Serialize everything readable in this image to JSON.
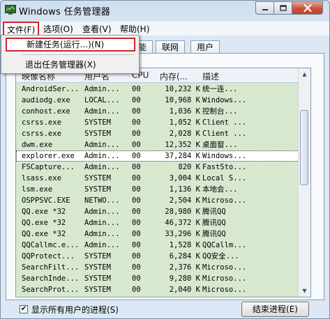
{
  "window": {
    "title": "Windows 任务管理器"
  },
  "menubar": {
    "file": "文件(F)",
    "options": "选项(O)",
    "view": "查看(V)",
    "help": "帮助(H)"
  },
  "file_menu": {
    "new_task": "新建任务(运行...)(N)",
    "exit": "退出任务管理器(X)"
  },
  "tabs": {
    "visible": [
      "能",
      "联网",
      "用户"
    ]
  },
  "table": {
    "columns": [
      "映像名称",
      "用户名",
      "CPU",
      "内存(...",
      "描述"
    ],
    "rows": [
      {
        "name": "AndroidSer...",
        "user": "Admin...",
        "cpu": "00",
        "mem": "10,232 K",
        "desc": "统一连..."
      },
      {
        "name": "audiodg.exe",
        "user": "LOCAL...",
        "cpu": "00",
        "mem": "10,968 K",
        "desc": "Windows..."
      },
      {
        "name": "conhost.exe",
        "user": "Admin...",
        "cpu": "00",
        "mem": "1,036 K",
        "desc": "控制台..."
      },
      {
        "name": "csrss.exe",
        "user": "SYSTEM",
        "cpu": "00",
        "mem": "1,052 K",
        "desc": "Client ..."
      },
      {
        "name": "csrss.exe",
        "user": "SYSTEM",
        "cpu": "00",
        "mem": "2,028 K",
        "desc": "Client ..."
      },
      {
        "name": "dwm.exe",
        "user": "Admin...",
        "cpu": "00",
        "mem": "12,352 K",
        "desc": "桌面窗..."
      },
      {
        "name": "explorer.exe",
        "user": "Admin...",
        "cpu": "00",
        "mem": "37,284 K",
        "desc": "Windows..."
      },
      {
        "name": "FSCapture...",
        "user": "Admin...",
        "cpu": "00",
        "mem": "820 K",
        "desc": "FastSto..."
      },
      {
        "name": "lsass.exe",
        "user": "SYSTEM",
        "cpu": "00",
        "mem": "3,004 K",
        "desc": "Local S..."
      },
      {
        "name": "lsm.exe",
        "user": "SYSTEM",
        "cpu": "00",
        "mem": "1,136 K",
        "desc": "本地会..."
      },
      {
        "name": "OSPPSVC.EXE",
        "user": "NETWO...",
        "cpu": "00",
        "mem": "2,504 K",
        "desc": "Microso..."
      },
      {
        "name": "QQ.exe *32",
        "user": "Admin...",
        "cpu": "00",
        "mem": "28,980 K",
        "desc": "腾讯QQ"
      },
      {
        "name": "QQ.exe *32",
        "user": "Admin...",
        "cpu": "00",
        "mem": "46,372 K",
        "desc": "腾讯QQ"
      },
      {
        "name": "QQ.exe *32",
        "user": "Admin...",
        "cpu": "00",
        "mem": "33,296 K",
        "desc": "腾讯QQ"
      },
      {
        "name": "QQCallmc.e...",
        "user": "Admin...",
        "cpu": "00",
        "mem": "1,528 K",
        "desc": "QQCallm..."
      },
      {
        "name": "QQProtect...",
        "user": "SYSTEM",
        "cpu": "00",
        "mem": "6,284 K",
        "desc": "QQ安全..."
      },
      {
        "name": "SearchFilt...",
        "user": "SYSTEM",
        "cpu": "00",
        "mem": "2,376 K",
        "desc": "Microso..."
      },
      {
        "name": "SearchInde...",
        "user": "SYSTEM",
        "cpu": "00",
        "mem": "9,280 K",
        "desc": "Microso..."
      },
      {
        "name": "SearchProt...",
        "user": "SYSTEM",
        "cpu": "00",
        "mem": "2,040 K",
        "desc": "Microso..."
      }
    ]
  },
  "bottom": {
    "show_all_label": "显示所有用户的进程(S)",
    "end_process_label": "结束进程(E)",
    "show_all_checked": "✔"
  }
}
